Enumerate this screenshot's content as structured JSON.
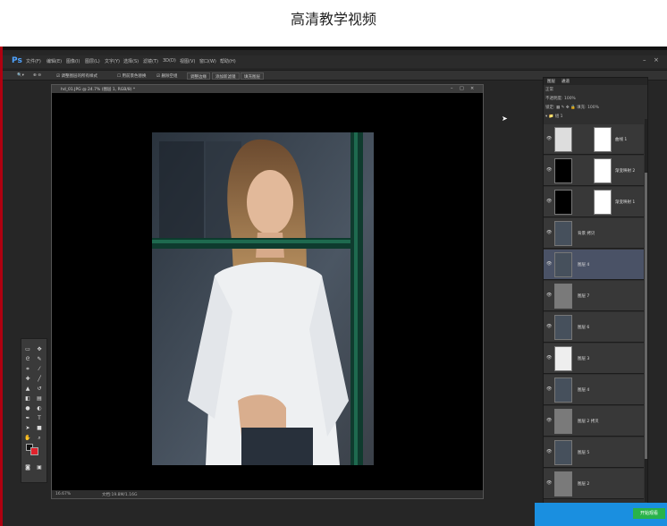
{
  "page": {
    "title": "高清教学视频"
  },
  "ps": {
    "logo": "Ps",
    "menu": [
      "文件(F)",
      "编辑(E)",
      "图像(I)",
      "图层(L)",
      "文字(Y)",
      "选择(S)",
      "滤镜(T)",
      "3D(D)",
      "视图(V)",
      "窗口(W)",
      "帮助(H)"
    ],
    "options": {
      "check1": "☑ 调整图层的所有样式",
      "check2": "☐ 用前景色替换",
      "check3": "☑ 删除空组",
      "btn1": "调整边缘",
      "btn2": "添加新滤镜",
      "btn3": "填充图层"
    },
    "document": {
      "tab_label": "hd_01.JPG @ 24.7% (图层 1, RGB/8) *",
      "zoom": "16.67%",
      "doc_size": "文档:19.8M/1.16G"
    }
  },
  "layers": {
    "tabs": [
      "图层",
      "通道"
    ],
    "blend_mode": "正常",
    "opacity_label": "不透明度:",
    "opacity": "100%",
    "lock_label": "锁定:",
    "fill_label": "填充:",
    "fill": "100%",
    "group_name": "组 1",
    "items": [
      {
        "name": "曲线 1",
        "selected": false,
        "thumb": "adjust"
      },
      {
        "name": "渐变映射 2",
        "selected": false,
        "thumb": "black"
      },
      {
        "name": "渐变映射 1",
        "selected": false,
        "thumb": "black"
      },
      {
        "name": "背景 拷贝",
        "selected": false,
        "thumb": "photo"
      },
      {
        "name": "图层 4",
        "selected": true,
        "thumb": "photo"
      },
      {
        "name": "图层 7",
        "selected": false,
        "thumb": "gray"
      },
      {
        "name": "图层 6",
        "selected": false,
        "thumb": "photo"
      },
      {
        "name": "图层 3",
        "selected": false,
        "thumb": "checker"
      },
      {
        "name": "图层 4",
        "selected": false,
        "thumb": "photo"
      },
      {
        "name": "图层 2 拷贝",
        "selected": false,
        "thumb": "gray"
      },
      {
        "name": "图层 5",
        "selected": false,
        "thumb": "photo"
      },
      {
        "name": "图层 2",
        "selected": false,
        "thumb": "gray"
      }
    ]
  },
  "overlay": {
    "button": "开始观看"
  },
  "colors": {
    "accent": "#1a8fe0",
    "foreground": "#111111",
    "background_color": "#e0222c",
    "selected_layer": "#4a5266"
  }
}
